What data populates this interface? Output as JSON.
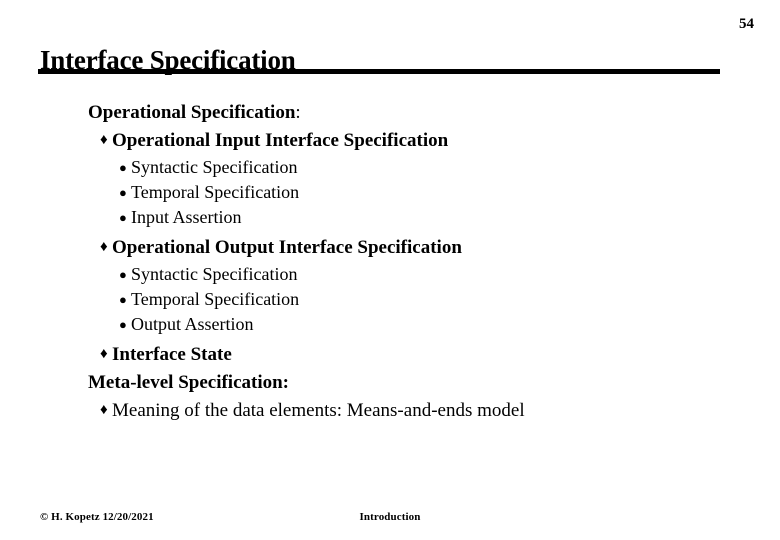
{
  "slide": {
    "page_number": "54",
    "title": "Interface Specification",
    "bullet_glyphs": {
      "level1": "♦",
      "level2": "●"
    },
    "sections": [
      {
        "heading_text": "Operational Specification",
        "heading_colon": ":",
        "items": [
          {
            "text": "Operational Input Interface Specification",
            "subitems": [
              "Syntactic Specification",
              "Temporal Specification",
              "Input Assertion"
            ]
          },
          {
            "text": "Operational Output Interface Specification",
            "subitems": [
              "Syntactic Specification",
              "Temporal Specification",
              "Output Assertion"
            ]
          },
          {
            "text": "Interface State",
            "subitems": []
          }
        ]
      },
      {
        "heading_text": "Meta-level Specification:",
        "heading_colon": "",
        "items": [
          {
            "text": "Meaning of the data elements: Means-and-ends model",
            "subitems": []
          }
        ]
      }
    ]
  },
  "footer": {
    "left": "© H. Kopetz  12/20/2021",
    "center": "Introduction"
  },
  "colors": {
    "background": "#ffffff",
    "text": "#000000",
    "rule": "#000000"
  }
}
